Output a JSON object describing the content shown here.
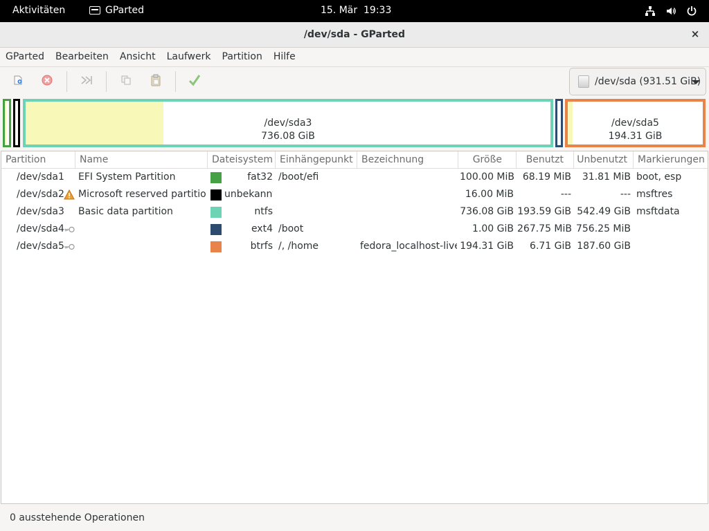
{
  "topbar": {
    "activities": "Aktivitäten",
    "app_name": "GParted",
    "clock": "15. Mär  19:33",
    "icons": [
      "network-icon",
      "volume-icon",
      "power-icon"
    ]
  },
  "window": {
    "title": "/dev/sda - GParted",
    "close": "×"
  },
  "menu": [
    "GParted",
    "Bearbeiten",
    "Ansicht",
    "Laufwerk",
    "Partition",
    "Hilfe"
  ],
  "toolbar": {
    "buttons": [
      "new-icon",
      "delete-icon",
      "resize-move-icon",
      "copy-icon",
      "paste-icon",
      "apply-icon"
    ],
    "device": "/dev/sda (931.51 GiB)"
  },
  "diskmap": {
    "sda3": {
      "name": "/dev/sda3",
      "size": "736.08 GiB",
      "used_fraction": 0.263
    },
    "sda5": {
      "name": "/dev/sda5",
      "size": "194.31 GiB",
      "used_fraction": 0.035
    }
  },
  "colors": {
    "fat32": "#46a046",
    "unbekannt": "#000000",
    "ntfs": "#6ed2b4",
    "ext4": "#2d4b6e",
    "btrfs": "#e8844a",
    "used": "#f8f8b8"
  },
  "table": {
    "headers": [
      "Partition",
      "Name",
      "Dateisystem",
      "Einhängepunkt",
      "Bezeichnung",
      "Größe",
      "Benutzt",
      "Unbenutzt",
      "Markierungen"
    ],
    "rows": [
      {
        "partition": "/dev/sda1",
        "name": "EFI System Partition",
        "fs": "fat32",
        "mount": "/boot/efi",
        "label": "",
        "size": "100.00 MiB",
        "used": "68.19 MiB",
        "unused": "31.81 MiB",
        "flags": "boot, esp",
        "icon": ""
      },
      {
        "partition": "/dev/sda2",
        "name": "Microsoft reserved partition",
        "fs": "unbekannt",
        "mount": "",
        "label": "",
        "size": "16.00 MiB",
        "used": "---",
        "unused": "---",
        "flags": "msftres",
        "icon": "warning-icon"
      },
      {
        "partition": "/dev/sda3",
        "name": "Basic data partition",
        "fs": "ntfs",
        "mount": "",
        "label": "",
        "size": "736.08 GiB",
        "used": "193.59 GiB",
        "unused": "542.49 GiB",
        "flags": "msftdata",
        "icon": ""
      },
      {
        "partition": "/dev/sda4",
        "name": "",
        "fs": "ext4",
        "mount": "/boot",
        "label": "",
        "size": "1.00 GiB",
        "used": "267.75 MiB",
        "unused": "756.25 MiB",
        "flags": "",
        "icon": "key-icon"
      },
      {
        "partition": "/dev/sda5",
        "name": "",
        "fs": "btrfs",
        "mount": "/, /home",
        "label": "fedora_localhost-live",
        "size": "194.31 GiB",
        "used": "6.71 GiB",
        "unused": "187.60 GiB",
        "flags": "",
        "icon": "key-icon"
      }
    ]
  },
  "status": "0 ausstehende Operationen"
}
